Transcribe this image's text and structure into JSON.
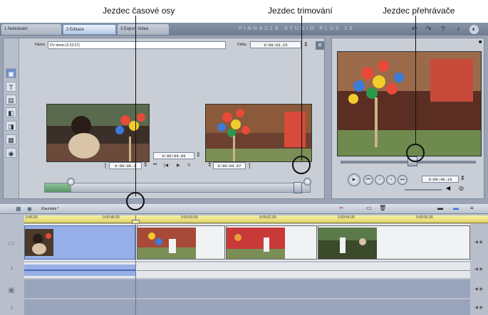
{
  "annotations": {
    "timeline_scrubber": "Jezdec časové osy",
    "trim_scrubber": "Jezdec trimování",
    "player_scrubber": "Jezdec přehrávače"
  },
  "app": {
    "brand": "PINNACLE STUDIO PLUS 10",
    "tabs": [
      {
        "label": "1 Nahrávání"
      },
      {
        "label": "2 Editace"
      },
      {
        "label": "3 Export Videa"
      }
    ],
    "active_tab": 1
  },
  "editor": {
    "name_label": "Název",
    "name_value": "DV demo [2:33:27]",
    "duration_label": "Délka",
    "duration_value": "0:00:03.25",
    "current_tc": "0:00:04.06",
    "in_tc": "0:00:00.3",
    "out_tc": "0:00:04.07",
    "trim_position": 0.1,
    "trim_out_position": 0.97
  },
  "player": {
    "timecode": "0:00:40.19",
    "scrub_position": 0.53
  },
  "timeline": {
    "project_label": "Klaunáda *",
    "ticks": [
      "0:46.00",
      "0:00:48.00",
      "0:00:50.00",
      "0:00:52.00",
      "0:00:54.00",
      "0:00:56.00"
    ]
  },
  "colors": {
    "app_bg": "#9aa4b4",
    "panel_bg": "#c9ced6",
    "ruler": "#e8da78",
    "selected_clip": "#97afe8"
  }
}
